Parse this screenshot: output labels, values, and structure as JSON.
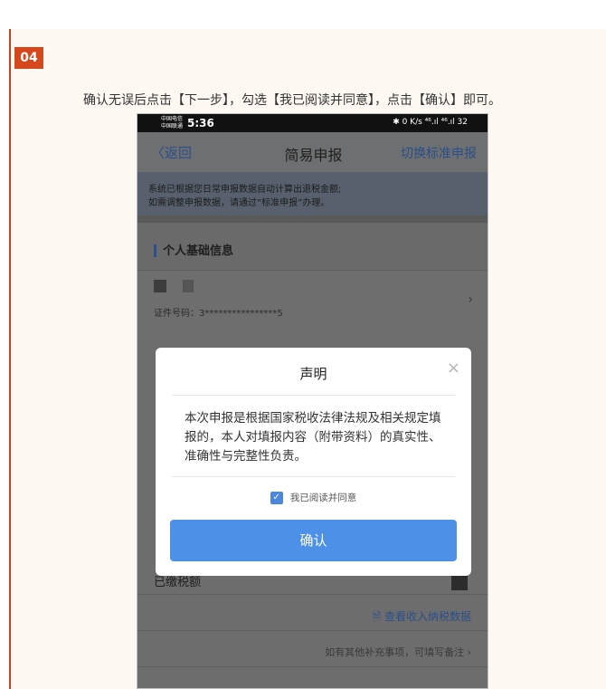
{
  "step": {
    "number": "04"
  },
  "instruction": "确认无误后点击【下一步】，勾选【我已阅读并同意】，点击【确认】即可。",
  "phone": {
    "status_bar": {
      "carrier_line1": "中国电信",
      "carrier_line2": "中国联通",
      "time": "5:36",
      "right": "✱ 0 K/s ⁴⁶.ıl ⁴⁶.ıl 32"
    },
    "nav": {
      "back_label": "〈返回",
      "title": "简易申报",
      "switch_label": "切换标准申报"
    },
    "notice": {
      "line1": "系统已根据您日常申报数据自动计算出退税金额;",
      "line2": "如需调整申报数据，请通过“标准申报”办理。"
    },
    "section_title": "个人基础信息",
    "id_number": "证件号码：3****************5",
    "paid_tax_label": "已缴税额",
    "view_data_link": "查看收入纳税数据",
    "remark_link": "如有其他补充事项，可填写备注"
  },
  "modal": {
    "title": "声明",
    "close_glyph": "×",
    "body": "本次申报是根据国家税收法律法规及相关规定填报的，本人对填报内容（附带资料）的真实性、准确性与完整性负责。",
    "agree_label": "我已阅读并同意",
    "agree_checked": true,
    "confirm_label": "确认"
  },
  "colors": {
    "accent_red": "#d5481e",
    "link_blue": "#2a4f8a",
    "button_blue": "#4d90e8"
  }
}
